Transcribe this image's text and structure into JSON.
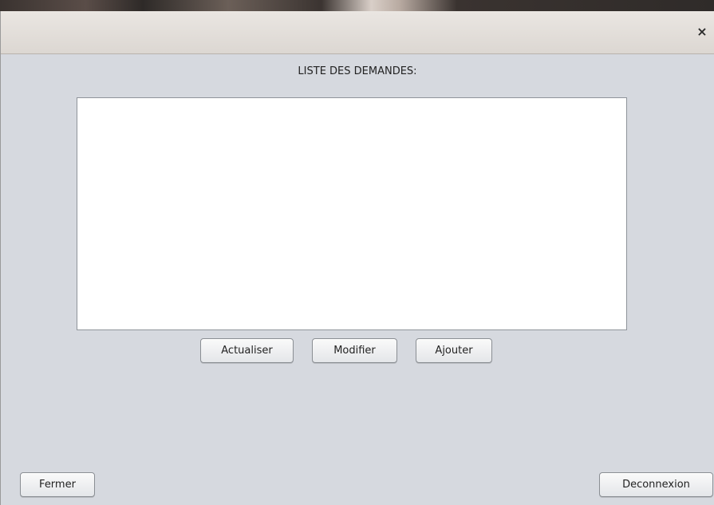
{
  "window": {
    "close_glyph": "×"
  },
  "main": {
    "heading": "LISTE DES DEMANDES:",
    "list_items": []
  },
  "actions": {
    "refresh_label": "Actualiser",
    "modify_label": "Modifier",
    "add_label": "Ajouter"
  },
  "footer": {
    "close_label": "Fermer",
    "logout_label": "Deconnexion"
  }
}
